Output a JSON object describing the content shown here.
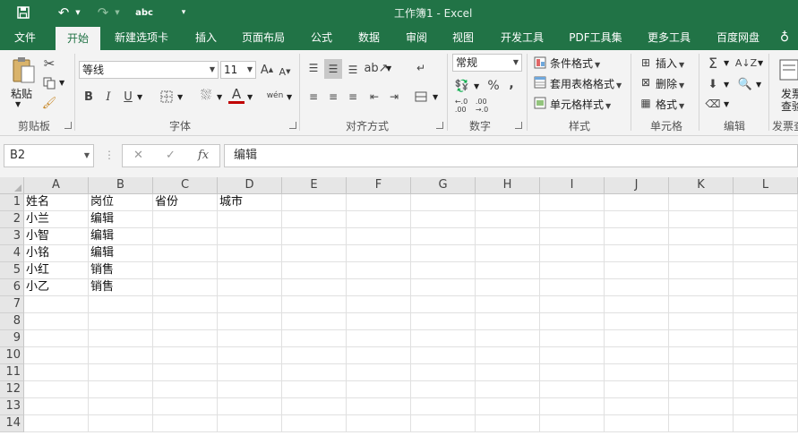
{
  "window": {
    "title": "工作簿1 - Excel"
  },
  "quick_access": {
    "spelling_label": "abc"
  },
  "tabs": [
    "文件",
    "开始",
    "新建选项卡",
    "插入",
    "页面布局",
    "公式",
    "数据",
    "审阅",
    "视图",
    "开发工具",
    "PDF工具集",
    "更多工具",
    "百度网盘"
  ],
  "ribbon": {
    "clipboard": {
      "paste_label": "粘贴",
      "group_label": "剪贴板"
    },
    "font": {
      "name": "等线",
      "size": "11",
      "bold": "B",
      "italic": "I",
      "underline": "U",
      "font_color_glyph": "A",
      "phonetic": "wén",
      "group_label": "字体"
    },
    "alignment": {
      "group_label": "对齐方式"
    },
    "number": {
      "format": "常规",
      "percent": "%",
      "comma": ",",
      "group_label": "数字"
    },
    "styles": {
      "conditional": "条件格式",
      "table_format": "套用表格格式",
      "cell_styles": "单元格样式",
      "group_label": "样式"
    },
    "cells": {
      "insert": "插入",
      "delete": "删除",
      "format": "格式",
      "group_label": "单元格"
    },
    "editing": {
      "group_label": "编辑"
    },
    "invoice": {
      "line1": "发票",
      "line2": "查验",
      "group_label": "发票查"
    }
  },
  "formula_bar": {
    "name_box": "B2",
    "fx": "fx",
    "content": "编辑"
  },
  "grid": {
    "columns": [
      "A",
      "B",
      "C",
      "D",
      "E",
      "F",
      "G",
      "H",
      "I",
      "J",
      "K",
      "L"
    ],
    "rows": [
      "1",
      "2",
      "3",
      "4",
      "5",
      "6",
      "7",
      "8",
      "9",
      "10",
      "11",
      "12",
      "13",
      "14"
    ],
    "cells": [
      [
        "姓名",
        "岗位",
        "省份",
        "城市"
      ],
      [
        "小兰",
        "编辑",
        "",
        ""
      ],
      [
        "小智",
        "编辑",
        "",
        ""
      ],
      [
        "小铭",
        "编辑",
        "",
        ""
      ],
      [
        "小红",
        "销售",
        "",
        ""
      ],
      [
        "小乙",
        "销售",
        "",
        ""
      ]
    ]
  },
  "colors": {
    "accent": "#217346",
    "ribbon_bg": "#f3f3f3",
    "header_bg": "#e6e6e6"
  }
}
